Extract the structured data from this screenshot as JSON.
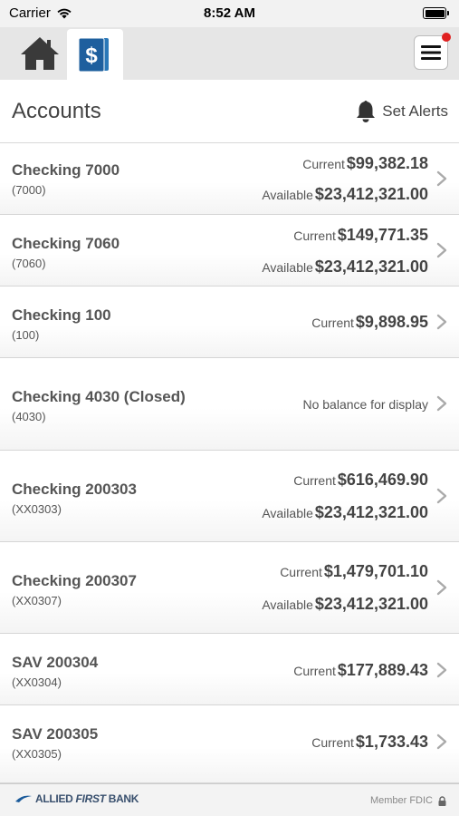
{
  "status_bar": {
    "carrier": "Carrier",
    "time": "8:52 AM"
  },
  "nav": {
    "home_icon": "home-icon",
    "accounts_icon": "accounts-dollar-icon",
    "menu_icon": "hamburger-menu-icon",
    "notification_color": "#e02020"
  },
  "header": {
    "title": "Accounts",
    "set_alerts_label": "Set Alerts"
  },
  "accounts": [
    {
      "name": "Checking 7000",
      "number": "(7000)",
      "current_label": "Current",
      "current": "$99,382.18",
      "available_label": "Available",
      "available": "$23,412,321.00"
    },
    {
      "name": "Checking 7060",
      "number": "(7060)",
      "current_label": "Current",
      "current": "$149,771.35",
      "available_label": "Available",
      "available": "$23,412,321.00"
    },
    {
      "name": "Checking 100",
      "number": "(100)",
      "current_label": "Current",
      "current": "$9,898.95"
    },
    {
      "name": "Checking 4030 (Closed)",
      "number": "(4030)",
      "no_balance": "No balance for display"
    },
    {
      "name": "Checking 200303",
      "number": "(XX0303)",
      "current_label": "Current",
      "current": "$616,469.90",
      "available_label": "Available",
      "available": "$23,412,321.00"
    },
    {
      "name": "Checking 200307",
      "number": "(XX0307)",
      "current_label": "Current",
      "current": "$1,479,701.10",
      "available_label": "Available",
      "available": "$23,412,321.00"
    },
    {
      "name": "SAV 200304",
      "number": "(XX0304)",
      "current_label": "Current",
      "current": "$177,889.43"
    },
    {
      "name": "SAV 200305",
      "number": "(XX0305)",
      "current_label": "Current",
      "current": "$1,733.43"
    }
  ],
  "footer": {
    "logo_text_1": "ALLIED",
    "logo_text_2": "FIRST",
    "logo_text_3": "BANK",
    "member_fdic": "Member FDIC",
    "brand_color": "#39506e",
    "accent_color": "#1a5a9a"
  }
}
